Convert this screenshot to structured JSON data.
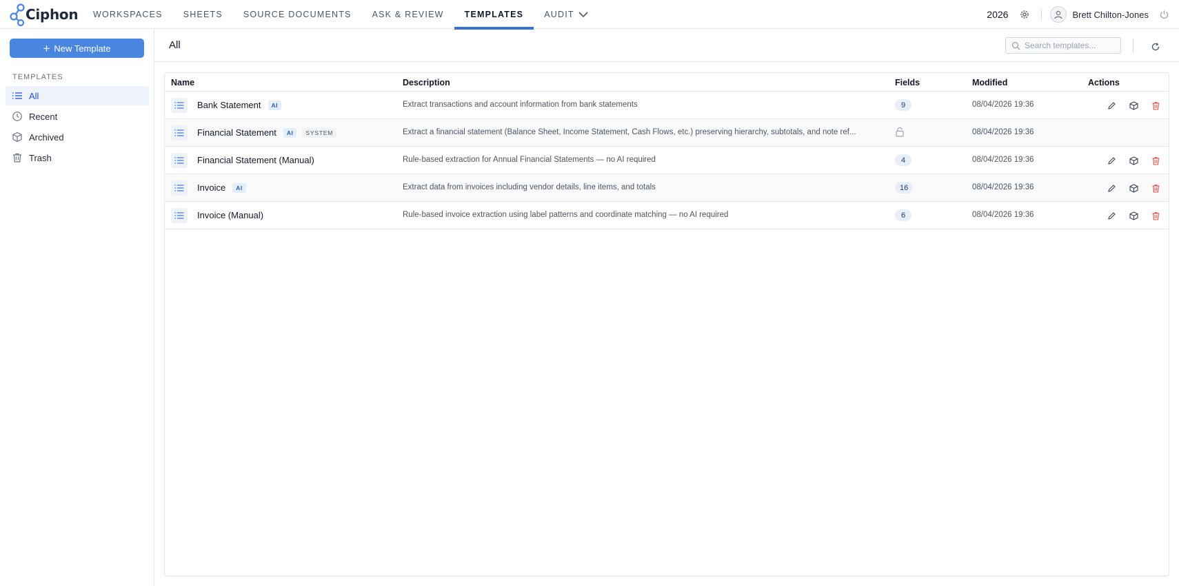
{
  "app": {
    "name": "Ciphon"
  },
  "nav": {
    "items": [
      {
        "label": "WORKSPACES"
      },
      {
        "label": "SHEETS"
      },
      {
        "label": "SOURCE DOCUMENTS"
      },
      {
        "label": "ASK & REVIEW"
      },
      {
        "label": "TEMPLATES",
        "active": true
      },
      {
        "label": "AUDIT"
      }
    ]
  },
  "header": {
    "year": "2026",
    "user_name": "Brett Chilton-Jones"
  },
  "sidebar": {
    "new_button_label": "New Template",
    "section_heading": "TEMPLATES",
    "items": [
      {
        "label": "All",
        "icon": "list-icon",
        "active": true
      },
      {
        "label": "Recent",
        "icon": "clock-icon"
      },
      {
        "label": "Archived",
        "icon": "box-icon"
      },
      {
        "label": "Trash",
        "icon": "trash-icon"
      }
    ]
  },
  "main": {
    "title": "All",
    "search": {
      "placeholder": "Search templates...",
      "value": ""
    }
  },
  "table": {
    "columns": {
      "name": "Name",
      "description": "Description",
      "fields": "Fields",
      "modified": "Modified",
      "actions": "Actions"
    },
    "rows": [
      {
        "name": "Bank Statement",
        "badge_ai": "AI",
        "badge_system": "",
        "description": "Extract transactions and account information from bank statements",
        "fields": "9",
        "modified": "08/04/2026 19:36",
        "locked": false
      },
      {
        "name": "Financial Statement",
        "badge_ai": "AI",
        "badge_system": "SYSTEM",
        "description": "Extract a financial statement (Balance Sheet, Income Statement, Cash Flows, etc.) preserving hierarchy, subtotals, and note ref...",
        "fields": "",
        "modified": "08/04/2026 19:36",
        "locked": true
      },
      {
        "name": "Financial Statement (Manual)",
        "badge_ai": "",
        "badge_system": "",
        "description": "Rule-based extraction for Annual Financial Statements — no AI required",
        "fields": "4",
        "modified": "08/04/2026 19:36",
        "locked": false
      },
      {
        "name": "Invoice",
        "badge_ai": "AI",
        "badge_system": "",
        "description": "Extract data from invoices including vendor details, line items, and totals",
        "fields": "16",
        "modified": "08/04/2026 19:36",
        "locked": false
      },
      {
        "name": "Invoice (Manual)",
        "badge_ai": "",
        "badge_system": "",
        "description": "Rule-based invoice extraction using label patterns and coordinate matching — no AI required",
        "fields": "6",
        "modified": "08/04/2026 19:36",
        "locked": false
      }
    ]
  },
  "colors": {
    "accent": "#3b6fd8",
    "button": "#4a86e0",
    "danger": "#d9534f"
  }
}
